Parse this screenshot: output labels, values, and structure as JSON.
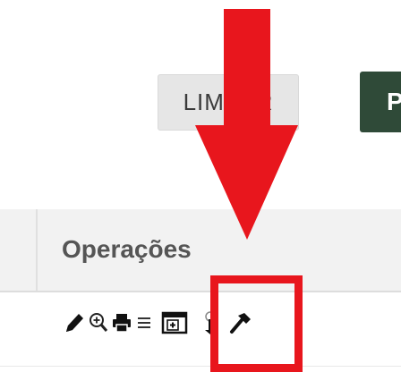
{
  "toolbar": {
    "clear_label": "LIMPAR",
    "search_label": "P",
    "search_color": "#2f4a38"
  },
  "table": {
    "header": {
      "operations_label": "Operações"
    },
    "row_actions": [
      {
        "name": "edit",
        "icon": "pencil-icon"
      },
      {
        "name": "view",
        "icon": "zoom-in-icon"
      },
      {
        "name": "print",
        "icon": "printer-icon"
      },
      {
        "name": "list",
        "icon": "list-icon"
      },
      {
        "name": "add-window",
        "icon": "window-plus-icon"
      },
      {
        "name": "upload",
        "icon": "upload-icon"
      },
      {
        "name": "judge",
        "icon": "gavel-icon"
      }
    ]
  },
  "annotation": {
    "color": "#e8161d"
  }
}
